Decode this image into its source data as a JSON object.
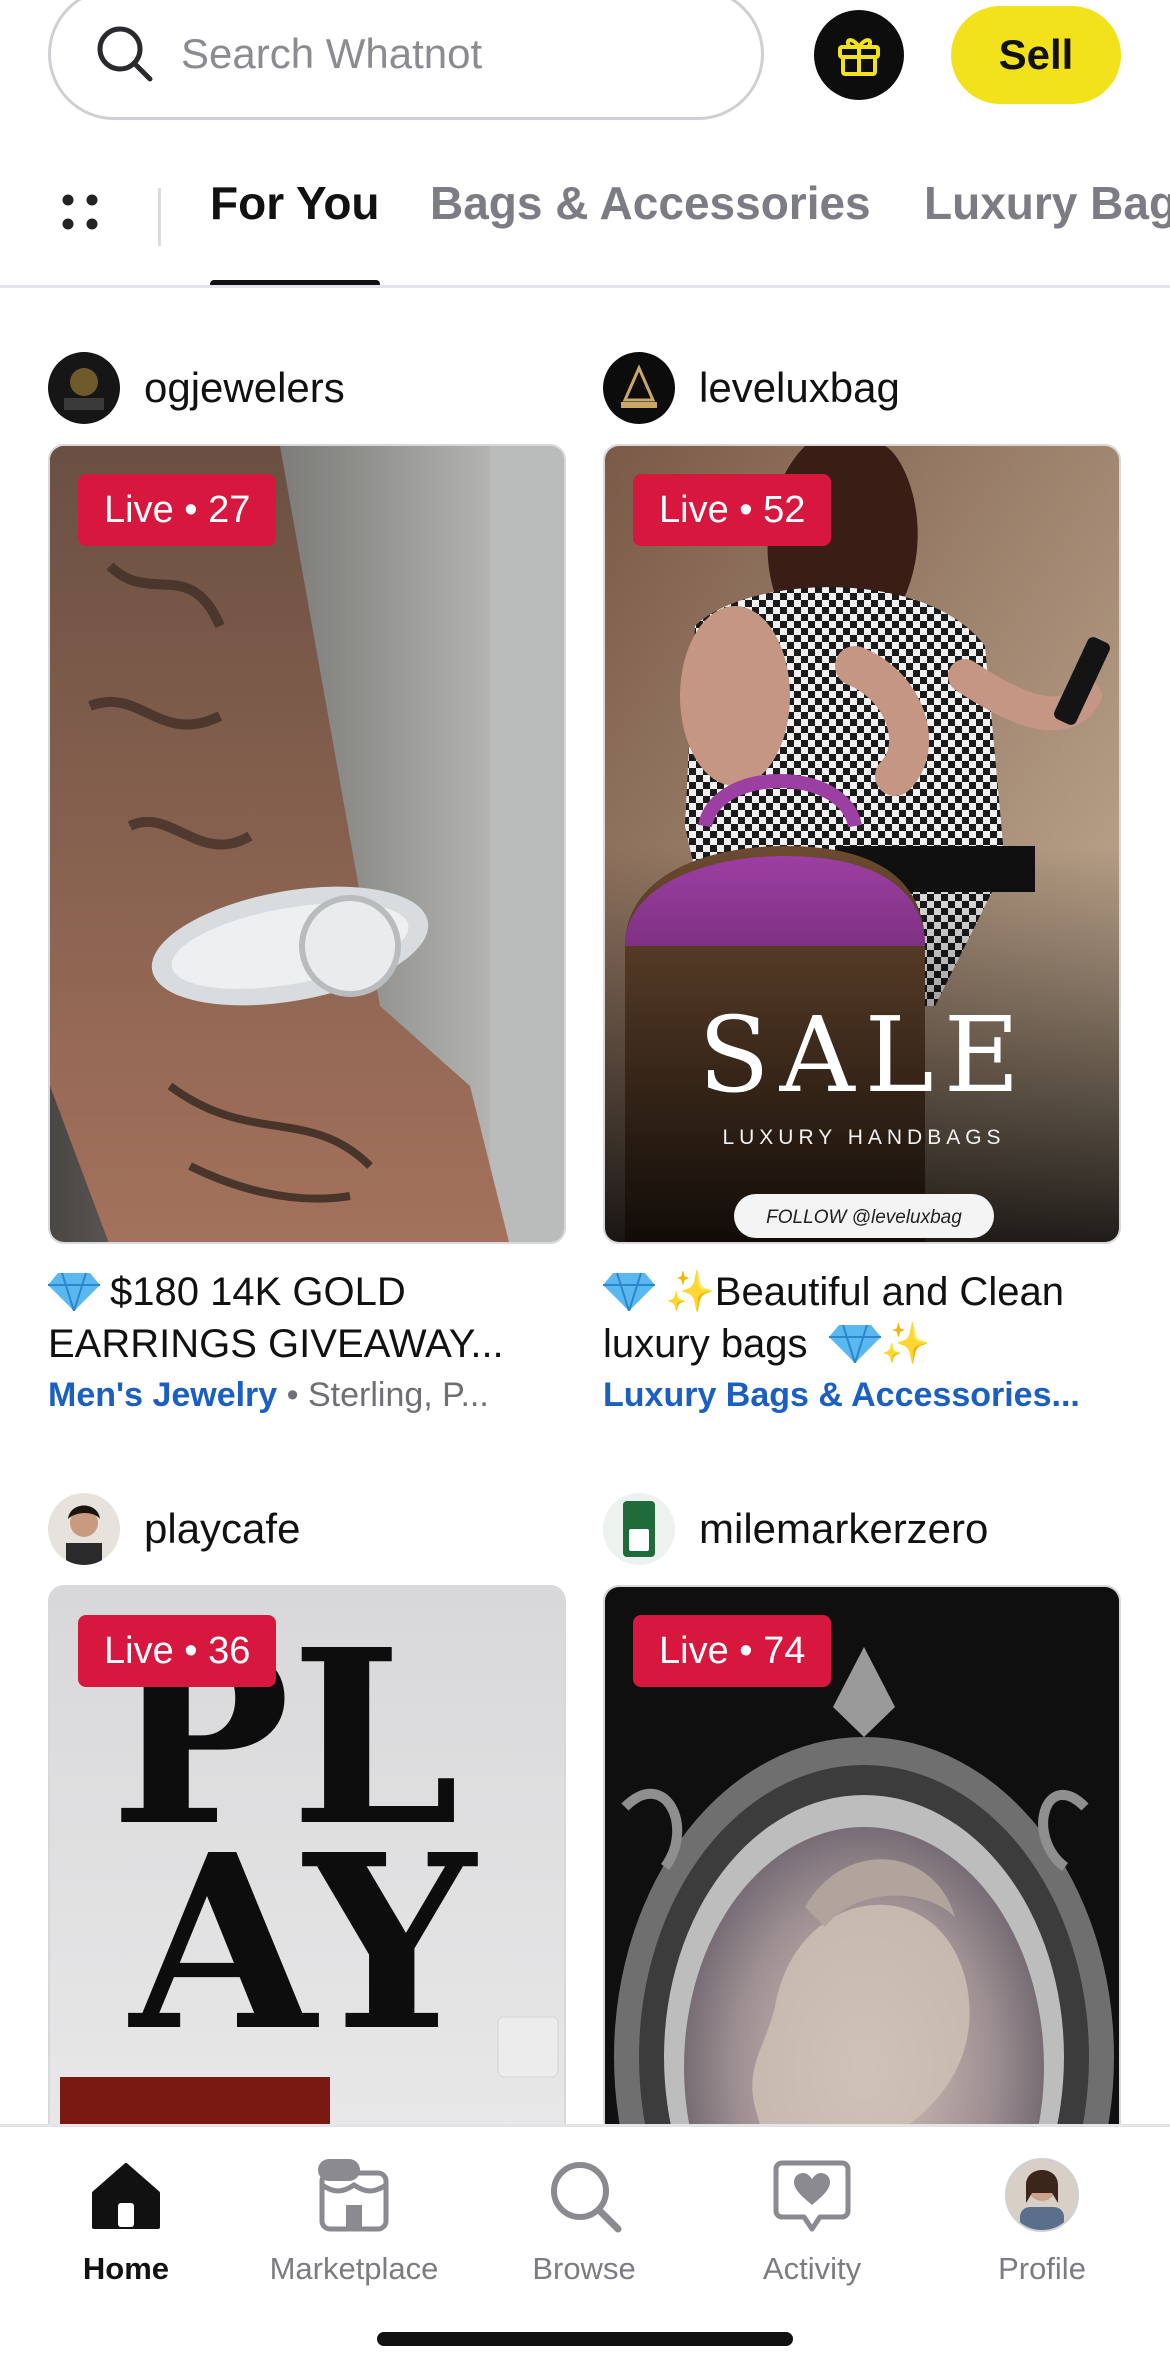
{
  "search": {
    "placeholder": "Search Whatnot"
  },
  "header": {
    "sell_label": "Sell"
  },
  "tabs": [
    {
      "label": "For You",
      "active": true
    },
    {
      "label": "Bags & Accessories",
      "active": false
    },
    {
      "label": "Luxury Bags",
      "active": false
    }
  ],
  "listings": [
    {
      "seller": "ogjewelers",
      "live_label": "Live • 27",
      "title": "$180 14K GOLD EARRINGS GIVEAWAY...",
      "category": "Men's Jewelry",
      "subcategory": " • Sterling, P..."
    },
    {
      "seller": "leveluxbag",
      "live_label": "Live • 52",
      "title": "✨Beautiful and Clean luxury bags",
      "title_suffix": "✨",
      "category": "Luxury Bags & Accessories...",
      "subcategory": "",
      "image_text": {
        "headline": "SALE",
        "subline": "LUXURY HANDBAGS",
        "follow": "FOLLOW @leveluxbag"
      }
    },
    {
      "seller": "playcafe",
      "live_label": "Live • 36",
      "image_text": {
        "line1": "PL",
        "line2": "AY"
      }
    },
    {
      "seller": "milemarkerzero",
      "live_label": "Live • 74"
    }
  ],
  "bottom_nav": [
    {
      "label": "Home",
      "icon": "home-icon",
      "active": true
    },
    {
      "label": "Marketplace",
      "icon": "marketplace-icon",
      "active": false
    },
    {
      "label": "Browse",
      "icon": "browse-icon",
      "active": false
    },
    {
      "label": "Activity",
      "icon": "activity-icon",
      "active": false
    },
    {
      "label": "Profile",
      "icon": "profile-avatar",
      "active": false
    }
  ],
  "colors": {
    "live_badge": "#d8173f",
    "sell_button": "#f1e21c",
    "category_link": "#1c5fc2"
  }
}
